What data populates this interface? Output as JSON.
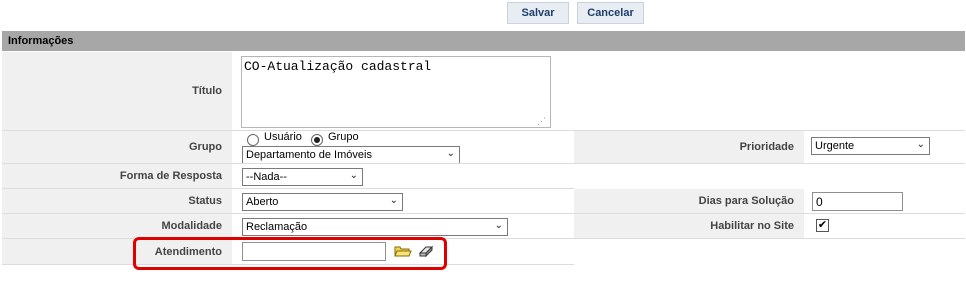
{
  "toolbar": {
    "save_label": "Salvar",
    "cancel_label": "Cancelar"
  },
  "section": {
    "title": "Informações"
  },
  "form": {
    "titulo_label": "Título",
    "titulo_value": "CO-Atualização cadastral",
    "grupo_label": "Grupo",
    "radio_usuario_label": "Usuário",
    "radio_grupo_label": "Grupo",
    "radio_selected": "Grupo",
    "grupo_select_value": "Departamento de Imóveis",
    "prioridade_label": "Prioridade",
    "prioridade_value": "Urgente",
    "forma_label": "Forma de Resposta",
    "forma_value": "--Nada--",
    "status_label": "Status",
    "status_value": "Aberto",
    "dias_label": "Dias para Solução",
    "dias_value": "0",
    "modalidade_label": "Modalidade",
    "modalidade_value": "Reclamação",
    "habilitar_label": "Habilitar no Site",
    "habilitar_checked": true,
    "habilitar_mark": "✔",
    "atendimento_label": "Atendimento",
    "atendimento_value": ""
  },
  "icons": {
    "folder": "folder-open-icon",
    "eraser": "eraser-icon",
    "dropdown": "chevron-down-icon"
  },
  "colors": {
    "header_bg": "#a7a7a7",
    "label_bg": "#f0f0f0",
    "button_text": "#1f3f6b",
    "highlight": "#e00000"
  }
}
